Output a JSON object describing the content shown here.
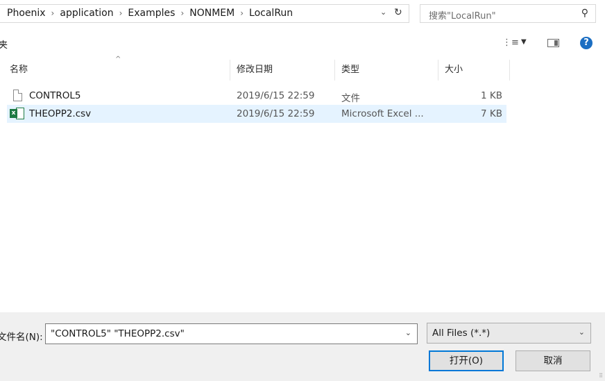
{
  "breadcrumb": [
    "Phoenix",
    "application",
    "Examples",
    "NONMEM",
    "LocalRun"
  ],
  "address_dropdown_icon": "chevron-down-icon",
  "address_refresh_icon": "refresh-icon",
  "search": {
    "placeholder": "搜索\"LocalRun\"",
    "icon": "search-icon"
  },
  "toolbar": {
    "partial_label": "夹",
    "view_icon": "view-options-icon",
    "pane_icon": "preview-pane-icon",
    "help_label": "?"
  },
  "columns": {
    "name": "名称",
    "date": "修改日期",
    "type": "类型",
    "size": "大小"
  },
  "files": [
    {
      "name": "CONTROL5",
      "date": "2019/6/15 22:59",
      "type": "文件",
      "size": "1 KB",
      "icon": "file-icon",
      "selected": false
    },
    {
      "name": "THEOPP2.csv",
      "date": "2019/6/15 22:59",
      "type": "Microsoft Excel ...",
      "size": "7 KB",
      "icon": "excel-icon",
      "selected": true
    }
  ],
  "filename": {
    "label": "文件名(N):",
    "value": "\"CONTROL5\" \"THEOPP2.csv\""
  },
  "filetype": {
    "value": "All Files (*.*)"
  },
  "buttons": {
    "open": "打开(O)",
    "cancel": "取消"
  },
  "colors": {
    "selection": "#e5f3ff",
    "accent": "#0078d7",
    "excel_green": "#1d7a43"
  }
}
